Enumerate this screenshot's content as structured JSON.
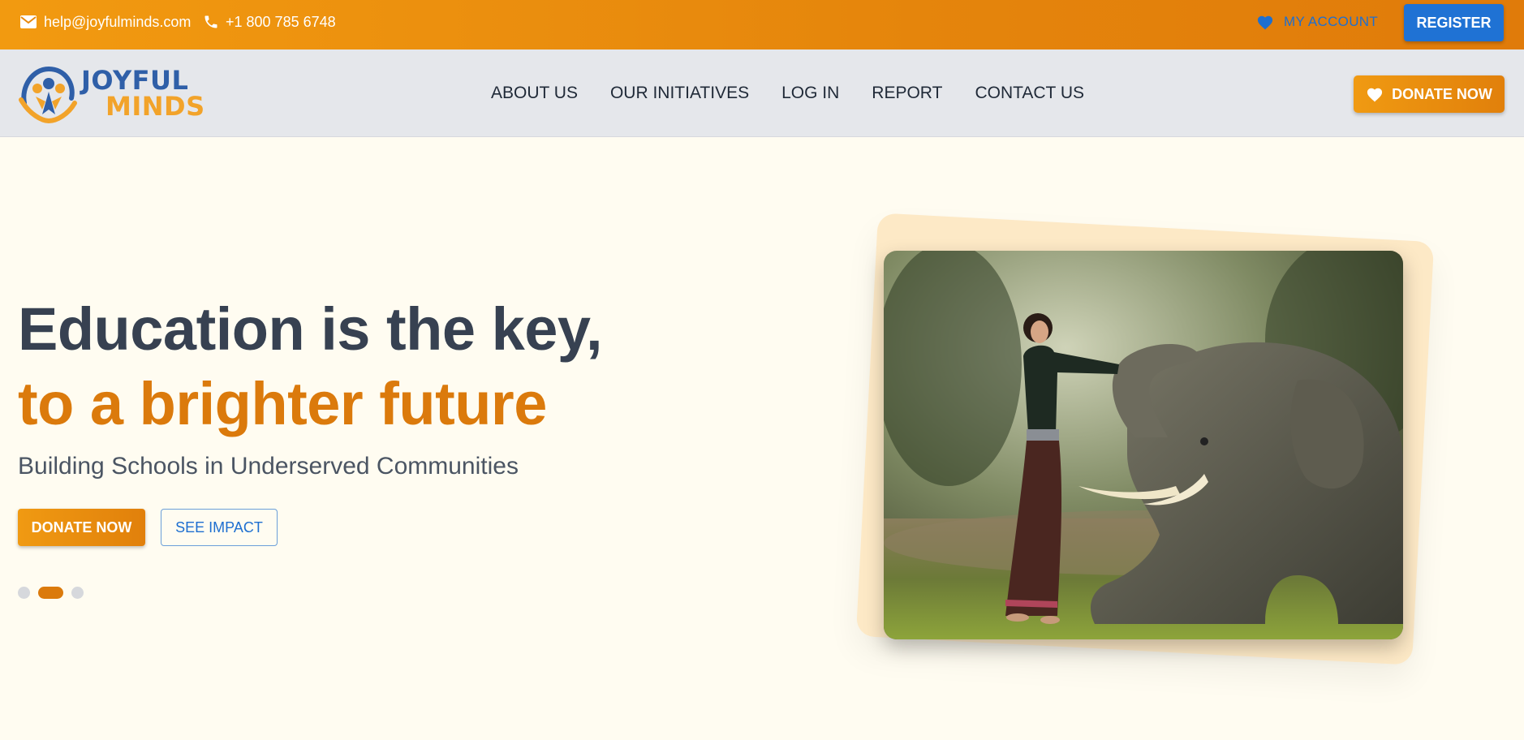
{
  "topbar": {
    "email": "help@joyfulminds.com",
    "phone": "+1 800 785 6748",
    "my_account": "MY ACCOUNT",
    "register": "REGISTER"
  },
  "brand": {
    "line1": "JOYFUL",
    "line2": "MINDS"
  },
  "nav": {
    "items": [
      {
        "label": "ABOUT US"
      },
      {
        "label": "OUR INITIATIVES"
      },
      {
        "label": "LOG IN"
      },
      {
        "label": "REPORT"
      },
      {
        "label": "CONTACT US"
      }
    ],
    "donate": "DONATE NOW"
  },
  "hero": {
    "headline_line1": "Education is the key,",
    "headline_line2": "to a brighter future",
    "subheading": "Building Schools in Underserved Communities",
    "donate_button": "DONATE NOW",
    "impact_button": "SEE IMPACT",
    "carousel": {
      "total_slides": 3,
      "active_slide": 2
    }
  },
  "icons": {
    "email": "mail-icon",
    "phone": "phone-icon",
    "account": "heart-icon",
    "donate": "heart-icon"
  },
  "colors": {
    "topbar_gradient": [
      "#f29a10",
      "#e07b0a"
    ],
    "accent_orange": "#db7a0c",
    "accent_blue": "#1f72d4",
    "nav_bg": "#e5e7eb",
    "hero_bg": "#fffcf1",
    "heading_dark": "#374151"
  }
}
